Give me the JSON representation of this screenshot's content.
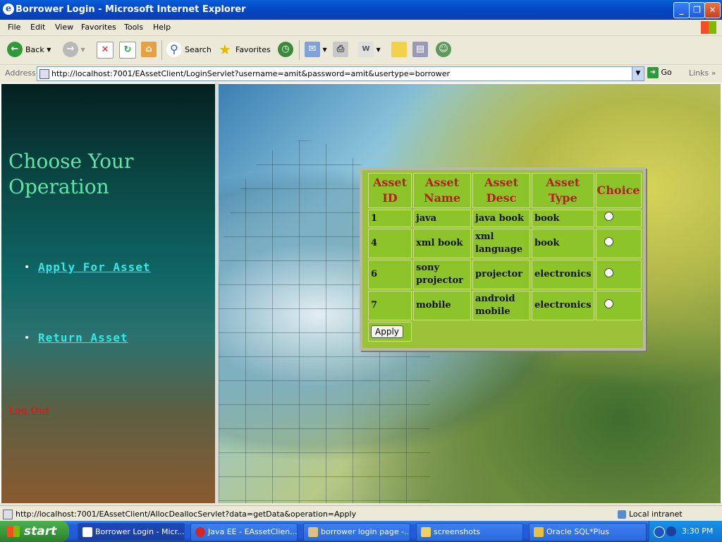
{
  "window": {
    "title": "Borrower Login - Microsoft Internet Explorer"
  },
  "menu": [
    "File",
    "Edit",
    "View",
    "Favorites",
    "Tools",
    "Help"
  ],
  "toolbar": {
    "back": "Back",
    "search": "Search",
    "favorites": "Favorites"
  },
  "address": {
    "label": "Address",
    "url": "http://localhost:7001/EAssetClient/LoginServlet?username=amit&password=amit&usertype=borrower",
    "go": "Go",
    "links": "Links"
  },
  "left": {
    "heading": "Choose Your Operation",
    "items": [
      {
        "label": "Apply For Asset"
      },
      {
        "label": "Return Asset"
      }
    ],
    "logout": "Log Out"
  },
  "table": {
    "headers": [
      "Asset ID",
      "Asset Name",
      "Asset Desc",
      "Asset Type",
      "Choice"
    ],
    "rows": [
      {
        "id": "1",
        "name": "java",
        "desc": "java book",
        "type": "book"
      },
      {
        "id": "4",
        "name": "xml book",
        "desc": "xml language",
        "type": "book"
      },
      {
        "id": "6",
        "name": "sony projector",
        "desc": "projector",
        "type": "electronics"
      },
      {
        "id": "7",
        "name": "mobile",
        "desc": "android mobile",
        "type": "electronics"
      }
    ],
    "apply": "Apply"
  },
  "status": {
    "text": "http://localhost:7001/EAssetClient/AllocDeallocServlet?data=getData&operation=Apply",
    "zone": "Local intranet"
  },
  "taskbar": {
    "start": "start",
    "tasks": [
      "Borrower Login - Micr...",
      "Java EE - EAssetClien...",
      "borrower login page -...",
      "screenshots",
      "Oracle SQL*Plus"
    ],
    "clock": "3:30 PM"
  }
}
